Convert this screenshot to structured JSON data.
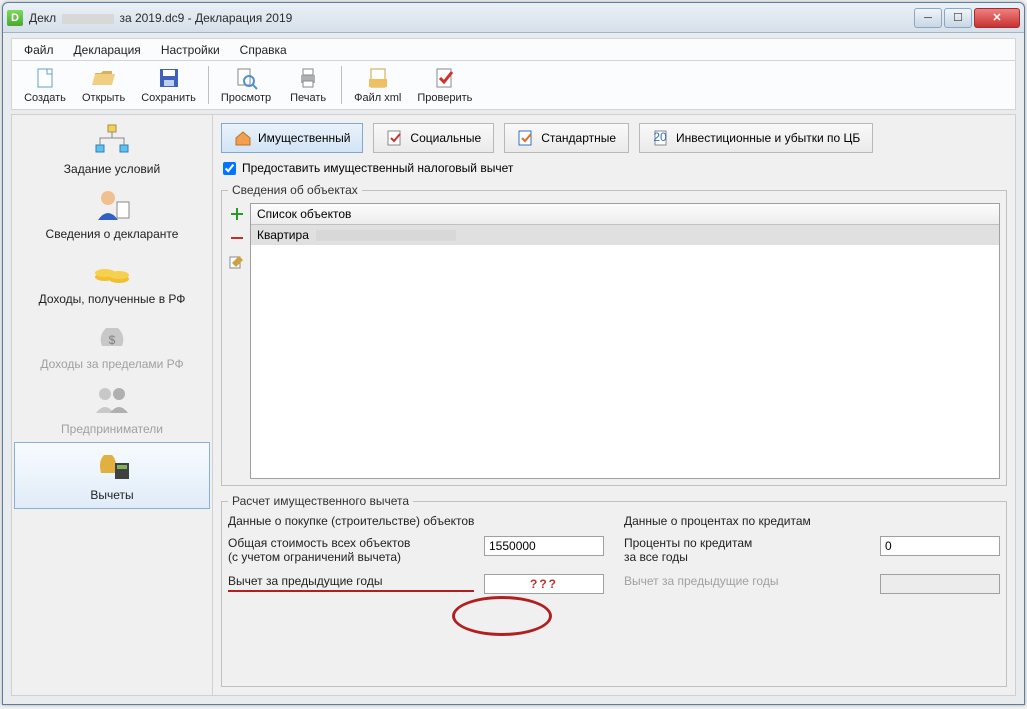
{
  "window": {
    "title_prefix": "Декл",
    "title_suffix": "за 2019.dc9 - Декларация 2019"
  },
  "menu": {
    "file": "Файл",
    "decl": "Декларация",
    "settings": "Настройки",
    "help": "Справка"
  },
  "toolbar": {
    "create": "Создать",
    "open": "Открыть",
    "save": "Сохранить",
    "preview": "Просмотр",
    "print": "Печать",
    "filexml": "Файл xml",
    "check": "Проверить"
  },
  "sidebar": {
    "conditions": "Задание условий",
    "declarant": "Сведения о декларанте",
    "income_rf": "Доходы, полученные в РФ",
    "income_abroad": "Доходы за пределами РФ",
    "entrepreneurs": "Предприниматели",
    "deductions": "Вычеты"
  },
  "tabs": {
    "property": "Имущественный",
    "social": "Социальные",
    "standard": "Стандартные",
    "invest": "Инвестиционные и убытки по ЦБ"
  },
  "checkbox_label": "Предоставить имущественный налоговый вычет",
  "objects": {
    "legend": "Сведения об объектах",
    "header": "Список объектов",
    "row1": "Квартира"
  },
  "calc": {
    "legend": "Расчет имущественного вычета",
    "left_title": "Данные о покупке (строительстве) объектов",
    "right_title": "Данные о процентах по кредитам",
    "total_cost_l1": "Общая стоимость всех объектов",
    "total_cost_l2": "(с учетом ограничений вычета)",
    "total_cost_value": "1550000",
    "prev_years": "Вычет за предыдущие годы",
    "prev_years_value": "???",
    "percent_l1": "Проценты по кредитам",
    "percent_l2": "за все годы",
    "percent_value": "0",
    "prev_years_right": "Вычет за предыдущие годы"
  }
}
